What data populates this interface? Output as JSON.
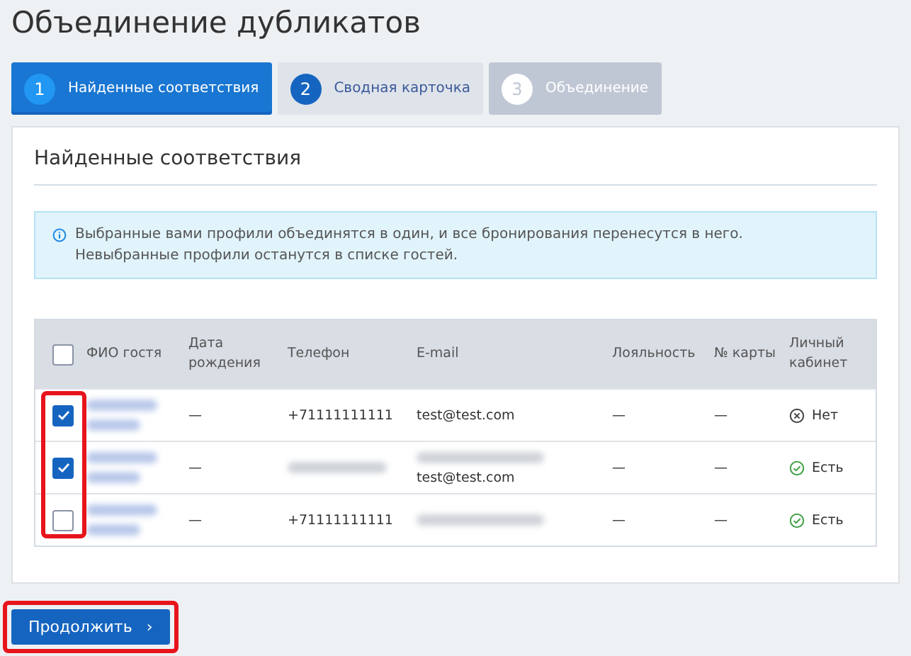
{
  "title": "Объединение дубликатов",
  "steps": [
    {
      "number": "1",
      "label": "Найденные соответствия",
      "selected": true,
      "disabled": false
    },
    {
      "number": "2",
      "label": "Сводная карточка",
      "selected": false,
      "disabled": false
    },
    {
      "number": "3",
      "label": "Объединение",
      "selected": false,
      "disabled": true
    }
  ],
  "section_title": "Найденные соответствия",
  "info": {
    "lines": [
      "Выбранные вами профили объединятся в один, и все бронирования перенесутся в него.",
      "Невыбранные профили останутся в списке гостей."
    ]
  },
  "table": {
    "select_all_checked": false,
    "selection_highlighted": true,
    "columns": [
      "ФИО гостя",
      "Дата рождения",
      "Телефон",
      "E-mail",
      "Лояльность",
      "№ карты",
      "Личный кабинет"
    ],
    "rows": [
      {
        "checked": true,
        "name_blurred": true,
        "birth": "—",
        "phone": {
          "text": "+71111111111",
          "blurred": false
        },
        "emails": [
          {
            "text": "test@test.com",
            "blurred": false
          }
        ],
        "loyalty": "—",
        "card": "—",
        "account": {
          "kind": "no",
          "label": "Нет"
        }
      },
      {
        "checked": true,
        "name_blurred": true,
        "birth": "—",
        "phone": {
          "blurred": true
        },
        "emails": [
          {
            "blurred": true
          },
          {
            "text": "test@test.com",
            "blurred": false
          }
        ],
        "loyalty": "—",
        "card": "—",
        "account": {
          "kind": "yes",
          "label": "Есть"
        }
      },
      {
        "checked": false,
        "name_blurred": true,
        "birth": "—",
        "phone": {
          "text": "+71111111111",
          "blurred": false
        },
        "emails": [
          {
            "blurred": true
          }
        ],
        "loyalty": "—",
        "card": "—",
        "account": {
          "kind": "yes",
          "label": "Есть"
        }
      }
    ]
  },
  "continue_button": {
    "label": "Продолжить",
    "chevron": "›",
    "highlighted": true
  }
}
